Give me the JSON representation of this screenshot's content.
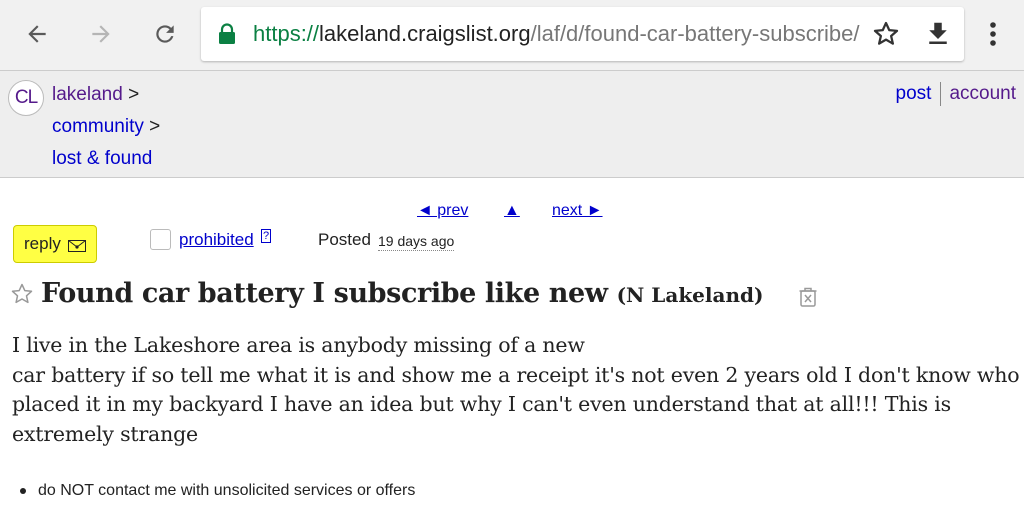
{
  "browser": {
    "url_scheme": "https://",
    "url_host": "lakeland.craigslist.org",
    "url_path": "/laf/d/found-car-battery-subscribe/"
  },
  "site": {
    "logo_text": "CL",
    "breadcrumb": [
      {
        "label": "lakeland",
        "separator": ">"
      },
      {
        "label": "community",
        "separator": ">"
      },
      {
        "label": "lost & found"
      }
    ],
    "user_links": {
      "post": "post",
      "account": "account"
    }
  },
  "posting_nav": {
    "prev": "◄ prev",
    "up": "▲",
    "next": "next ►"
  },
  "actions": {
    "reply_label": "reply",
    "prohibited_label": "prohibited",
    "help_label": "?",
    "posted_label": "Posted",
    "posted_date": "19 days ago"
  },
  "posting": {
    "title": "Found car battery I subscribe like new",
    "location": "(N Lakeland)",
    "body_lines": [
      "I live in the Lakeshore area is anybody missing of a new",
      "car battery if so tell me what it is and show me a receipt it's not even 2 years old I don't know who",
      "placed it in my backyard I have an idea but why I can't even understand that at all!!! This is",
      "extremely strange"
    ],
    "notices": [
      "do NOT contact me with unsolicited services or offers"
    ]
  },
  "colors": {
    "link": "#0000cc",
    "visited_link": "#551a8b",
    "reply_button": "#ffff44",
    "secure_scheme": "#0b8043"
  },
  "icons": [
    "back-arrow-icon",
    "forward-arrow-icon",
    "reload-icon",
    "lock-icon",
    "star-icon",
    "download-icon",
    "more-vert-icon",
    "mail-icon",
    "favorite-star-icon",
    "hide-trash-icon"
  ]
}
